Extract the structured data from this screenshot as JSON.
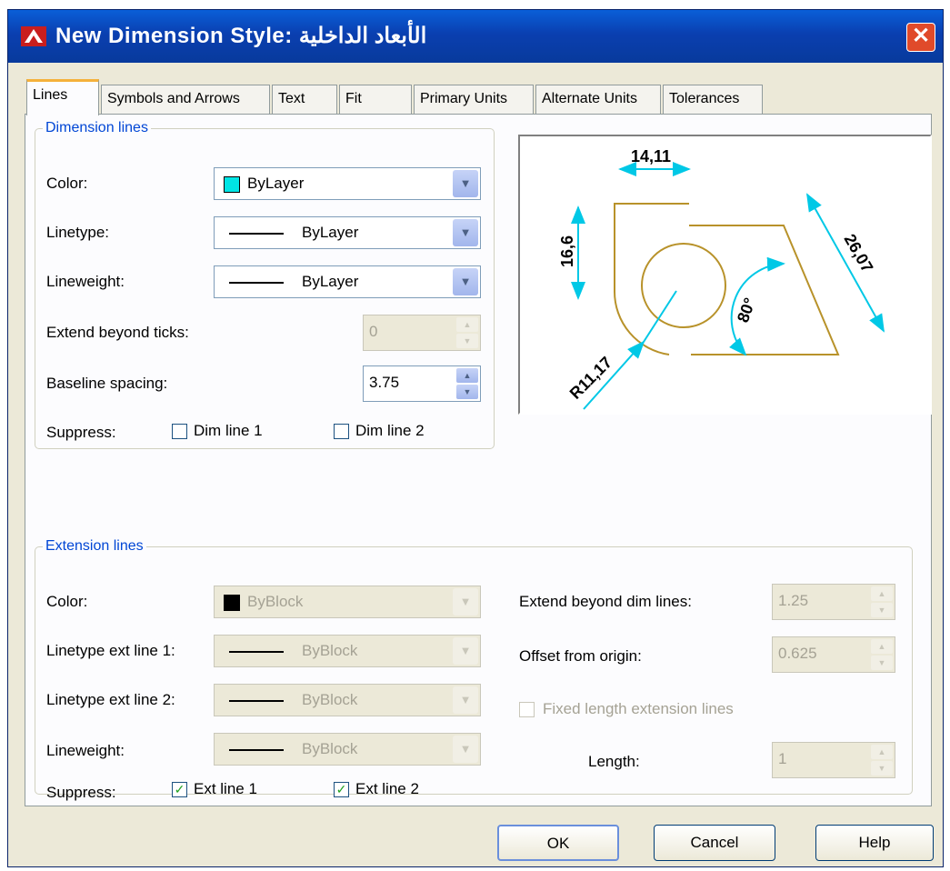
{
  "window": {
    "title": "New Dimension Style: الأبعاد الداخلية",
    "close_glyph": "✕"
  },
  "tabs": [
    {
      "label": "Lines",
      "active": true
    },
    {
      "label": "Symbols and Arrows"
    },
    {
      "label": "Text"
    },
    {
      "label": "Fit"
    },
    {
      "label": "Primary Units"
    },
    {
      "label": "Alternate Units"
    },
    {
      "label": "Tolerances"
    }
  ],
  "dimension_lines": {
    "legend": "Dimension lines",
    "color_label": "Color:",
    "color_value": "ByLayer",
    "color_swatch": "#00e5e5",
    "linetype_label": "Linetype:",
    "linetype_value": "ByLayer",
    "lineweight_label": "Lineweight:",
    "lineweight_value": "ByLayer",
    "extend_ticks_label": "Extend beyond ticks:",
    "extend_ticks_value": "0",
    "baseline_label": "Baseline spacing:",
    "baseline_value": "3.75",
    "suppress_label": "Suppress:",
    "dim_line_1": "Dim line 1",
    "dim_line_2": "Dim line 2"
  },
  "preview": {
    "dim_top": "14,11",
    "dim_left": "16,6",
    "dim_slant": "26,07",
    "dim_angle": "80°",
    "dim_radius": "R11,17",
    "dim_color": "#00c8e6",
    "geometry_color": "#b8922a"
  },
  "extension_lines": {
    "legend": "Extension lines",
    "color_label": "Color:",
    "color_value": "ByBlock",
    "color_swatch": "#000000",
    "linetype1_label": "Linetype ext line 1:",
    "linetype1_value": "ByBlock",
    "linetype2_label": "Linetype ext line 2:",
    "linetype2_value": "ByBlock",
    "lineweight_label": "Lineweight:",
    "lineweight_value": "ByBlock",
    "suppress_label": "Suppress:",
    "ext_line_1": "Ext line 1",
    "ext_line_2": "Ext line 2",
    "extend_dim_label": "Extend beyond dim lines:",
    "extend_dim_value": "1.25",
    "offset_label": "Offset from origin:",
    "offset_value": "0.625",
    "fixed_length_label": "Fixed length extension lines",
    "length_label": "Length:",
    "length_value": "1"
  },
  "buttons": {
    "ok": "OK",
    "cancel": "Cancel",
    "help": "Help"
  }
}
